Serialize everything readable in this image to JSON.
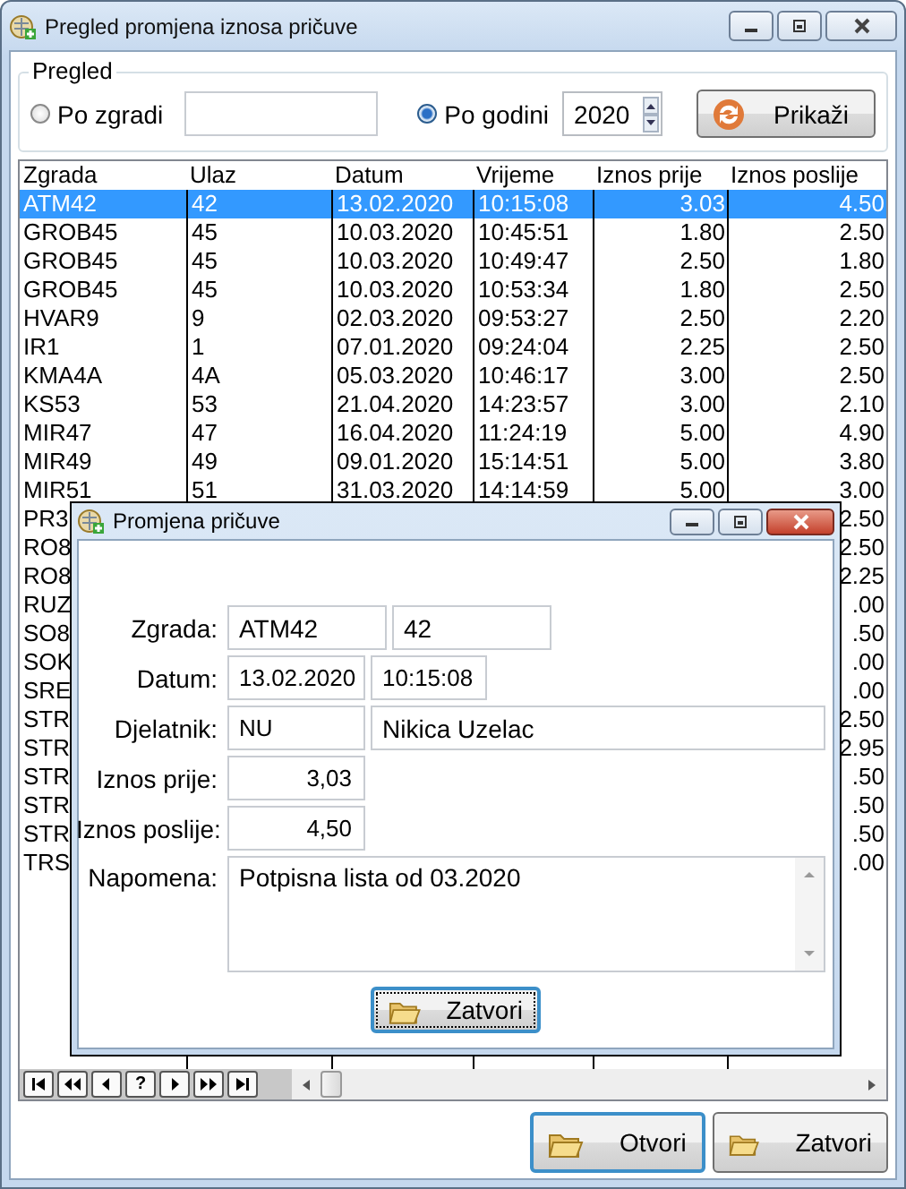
{
  "window": {
    "title": "Pregled promjena iznosa pričuve"
  },
  "filter": {
    "title": "Pregled",
    "options": [
      {
        "label": "Po zgradi",
        "selected": false
      },
      {
        "label": "Po godini",
        "selected": true
      }
    ],
    "year": "2020",
    "show_button": "Prikaži"
  },
  "table": {
    "columns": [
      "Zgrada",
      "Ulaz",
      "Datum",
      "Vrijeme",
      "Iznos prije",
      "Iznos poslije"
    ],
    "rows": [
      {
        "selected": true,
        "zgrada": "ATM42",
        "ulaz": "42",
        "datum": "13.02.2020",
        "vrijeme": "10:15:08",
        "iznos_prije": "3.03",
        "iznos_poslije": "4.50"
      },
      {
        "selected": false,
        "zgrada": "GROB45",
        "ulaz": "45",
        "datum": "10.03.2020",
        "vrijeme": "10:45:51",
        "iznos_prije": "1.80",
        "iznos_poslije": "2.50"
      },
      {
        "selected": false,
        "zgrada": "GROB45",
        "ulaz": "45",
        "datum": "10.03.2020",
        "vrijeme": "10:49:47",
        "iznos_prije": "2.50",
        "iznos_poslije": "1.80"
      },
      {
        "selected": false,
        "zgrada": "GROB45",
        "ulaz": "45",
        "datum": "10.03.2020",
        "vrijeme": "10:53:34",
        "iznos_prije": "1.80",
        "iznos_poslije": "2.50"
      },
      {
        "selected": false,
        "zgrada": "HVAR9",
        "ulaz": "9",
        "datum": "02.03.2020",
        "vrijeme": "09:53:27",
        "iznos_prije": "2.50",
        "iznos_poslije": "2.20"
      },
      {
        "selected": false,
        "zgrada": "IR1",
        "ulaz": "1",
        "datum": "07.01.2020",
        "vrijeme": "09:24:04",
        "iznos_prije": "2.25",
        "iznos_poslije": "2.50"
      },
      {
        "selected": false,
        "zgrada": "KMA4A",
        "ulaz": "4A",
        "datum": "05.03.2020",
        "vrijeme": "10:46:17",
        "iznos_prije": "3.00",
        "iznos_poslije": "2.50"
      },
      {
        "selected": false,
        "zgrada": "KS53",
        "ulaz": "53",
        "datum": "21.04.2020",
        "vrijeme": "14:23:57",
        "iznos_prije": "3.00",
        "iznos_poslije": "2.10"
      },
      {
        "selected": false,
        "zgrada": "MIR47",
        "ulaz": "47",
        "datum": "16.04.2020",
        "vrijeme": "11:24:19",
        "iznos_prije": "5.00",
        "iznos_poslije": "4.90"
      },
      {
        "selected": false,
        "zgrada": "MIR49",
        "ulaz": "49",
        "datum": "09.01.2020",
        "vrijeme": "15:14:51",
        "iznos_prije": "5.00",
        "iznos_poslije": "3.80"
      },
      {
        "selected": false,
        "zgrada": "MIR51",
        "ulaz": "51",
        "datum": "31.03.2020",
        "vrijeme": "14:14:59",
        "iznos_prije": "5.00",
        "iznos_poslije": "3.00"
      },
      {
        "selected": false,
        "zgrada": "PR3",
        "iznos_poslije": "2.50"
      },
      {
        "selected": false,
        "zgrada": "RO8",
        "iznos_poslije": "2.50"
      },
      {
        "selected": false,
        "zgrada": "RO8",
        "iznos_poslije": "2.25"
      },
      {
        "selected": false,
        "zgrada": "RUZ",
        "iznos_poslije": ".00"
      },
      {
        "selected": false,
        "zgrada": "SO8",
        "iznos_poslije": ".50"
      },
      {
        "selected": false,
        "zgrada": "SOK",
        "iznos_poslije": ".00"
      },
      {
        "selected": false,
        "zgrada": "SRE",
        "iznos_poslije": ".00"
      },
      {
        "selected": false,
        "zgrada": "STR",
        "iznos_poslije": "2.50"
      },
      {
        "selected": false,
        "zgrada": "STR",
        "iznos_poslije": "2.95"
      },
      {
        "selected": false,
        "zgrada": "STR",
        "iznos_poslije": ".50"
      },
      {
        "selected": false,
        "zgrada": "STR",
        "iznos_poslije": ".50"
      },
      {
        "selected": false,
        "zgrada": "STR",
        "iznos_poslije": ".50"
      },
      {
        "selected": false,
        "zgrada": "TRS",
        "iznos_poslije": ".00"
      }
    ]
  },
  "navigator": [
    {
      "kind": "first"
    },
    {
      "kind": "prev_page"
    },
    {
      "kind": "prev"
    },
    {
      "kind": "help",
      "label": "?"
    },
    {
      "kind": "next"
    },
    {
      "kind": "next_page"
    },
    {
      "kind": "last"
    }
  ],
  "buttons": [
    {
      "label": "Otvori",
      "default": true
    },
    {
      "label": "Zatvori",
      "default": false
    }
  ],
  "dialog": {
    "title": "Promjena pričuve",
    "fields": [
      {
        "kind": "text",
        "label": "Zgrada:",
        "values": [
          "ATM42",
          "42"
        ]
      },
      {
        "kind": "text",
        "label": "Datum:",
        "values": [
          "13.02.2020",
          "10:15:08"
        ]
      },
      {
        "kind": "text",
        "label": "Djelatnik:",
        "values": [
          "NU",
          "Nikica Uzelac"
        ]
      },
      {
        "kind": "amount",
        "label": "Iznos prije:",
        "values": [
          "3,03"
        ]
      },
      {
        "kind": "amount",
        "label": "Iznos poslije:",
        "values": [
          "4,50"
        ]
      }
    ],
    "note": {
      "label": "Napomena:",
      "value": "Potpisna lista od 03.2020"
    },
    "close_button": {
      "label": "Zatvori",
      "focused": true
    }
  }
}
